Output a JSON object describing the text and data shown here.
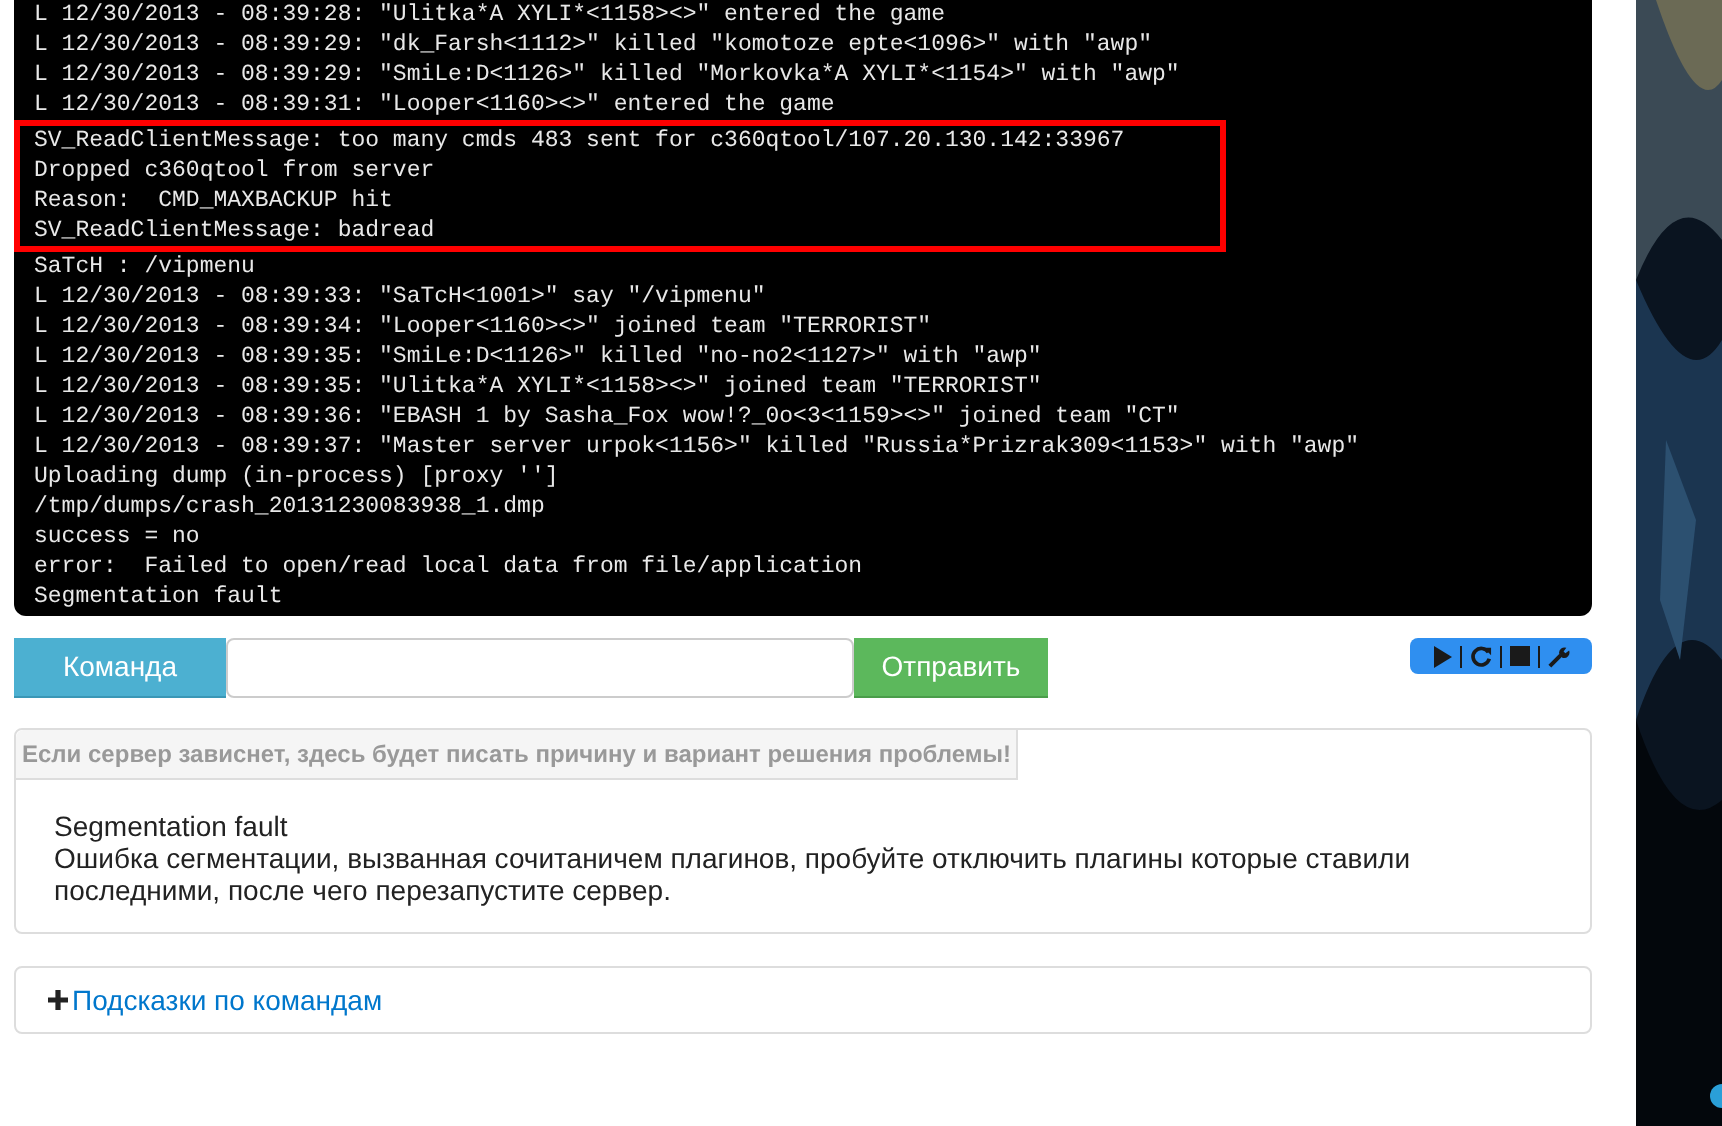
{
  "console": {
    "lines_before": [
      "L 12/30/2013 - 08:39:28: \"Ulitka*A XYLI*<1158><>\" entered the game",
      "L 12/30/2013 - 08:39:29: \"dk_Farsh<1112>\" killed \"komotoze epte<1096>\" with \"awp\"",
      "L 12/30/2013 - 08:39:29: \"SmiLe:D<1126>\" killed \"Morkovka*A XYLI*<1154>\" with \"awp\"",
      "L 12/30/2013 - 08:39:31: \"Looper<1160><>\" entered the game"
    ],
    "highlighted_lines": [
      "SV_ReadClientMessage: too many cmds 483 sent for c360qtool/107.20.130.142:33967",
      "Dropped c360qtool from server",
      "Reason:  CMD_MAXBACKUP hit",
      "SV_ReadClientMessage: badread"
    ],
    "lines_after": [
      "SaTcH : /vipmenu",
      "L 12/30/2013 - 08:39:33: \"SaTcH<1001>\" say \"/vipmenu\"",
      "L 12/30/2013 - 08:39:34: \"Looper<1160><>\" joined team \"TERRORIST\"",
      "L 12/30/2013 - 08:39:35: \"SmiLe:D<1126>\" killed \"no-no2<1127>\" with \"awp\"",
      "L 12/30/2013 - 08:39:35: \"Ulitka*A XYLI*<1158><>\" joined team \"TERRORIST\"",
      "L 12/30/2013 - 08:39:36: \"EBASH 1 by Sasha_Fox wow!?_0o<3<1159><>\" joined team \"CT\"",
      "L 12/30/2013 - 08:39:37: \"Master server urpok<1156>\" killed \"Russia*Prizrak309<1153>\" with \"awp\"",
      "Uploading dump (in-process) [proxy '']",
      "/tmp/dumps/crash_20131230083938_1.dmp",
      "success = no",
      "error:  Failed to open/read local data from file/application",
      "Segmentation fault"
    ]
  },
  "command_bar": {
    "label": "Команда",
    "send_button": "Отправить"
  },
  "server_controls": [
    {
      "kind": "play"
    },
    {
      "kind": "restart"
    },
    {
      "kind": "stop"
    },
    {
      "kind": "settings"
    }
  ],
  "problem_panel": {
    "heading": "Если сервер зависнет, здесь будет писать причину и вариант решения проблемы!",
    "title": "Segmentation fault",
    "description": "Ошибка сегментации, вызванная сочитаничем плагинов, пробуйте отключить плагины которые ставили последними, после чего перезапустите сервер."
  },
  "hints_panel": {
    "link": "Подсказки по командам"
  }
}
